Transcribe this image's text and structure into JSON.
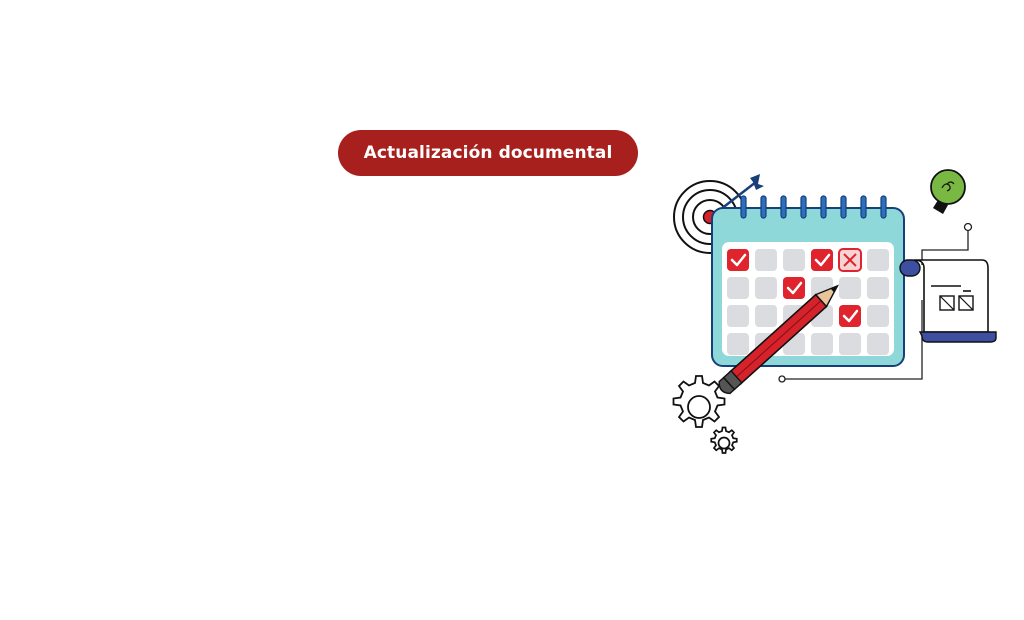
{
  "banner": {
    "label": "Actualización documental"
  },
  "colors": {
    "banner_bg": "#A8201D",
    "calendar_body": "#8FD8DA",
    "calendar_border": "#173F7A",
    "cell_grey": "#DADCDF",
    "check_red": "#E0242E",
    "pencil_red": "#D5222B",
    "bulb_green": "#79B943",
    "doc_blue": "#3D4FA0"
  },
  "illustration": {
    "icons": [
      "target-icon",
      "arrow-icon",
      "calendar-icon",
      "pencil-icon",
      "gear-icon",
      "lightbulb-icon",
      "document-scroll-icon"
    ]
  }
}
